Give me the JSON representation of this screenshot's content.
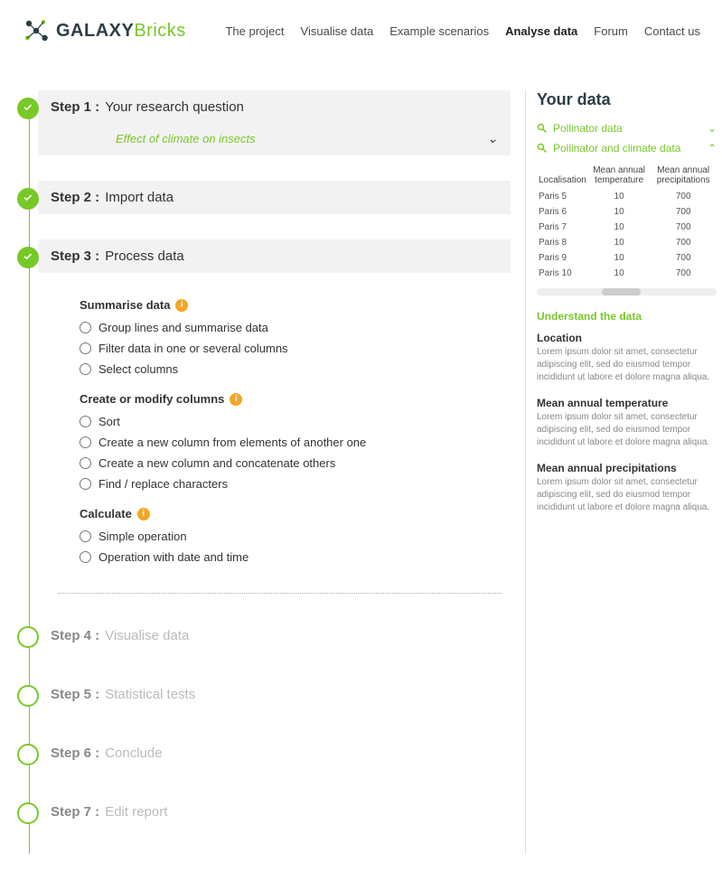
{
  "brand": {
    "part1": "GALAXY",
    "part2": "Bricks"
  },
  "nav": {
    "items": [
      "The project",
      "Visualise data",
      "Example scenarios",
      "Analyse data",
      "Forum",
      "Contact us"
    ],
    "activeIndex": 3
  },
  "steps": {
    "s1": {
      "bold": "Step 1 :",
      "label": "Your research question",
      "sub": "Effect of climate on insects"
    },
    "s2": {
      "bold": "Step 2 :",
      "label": "Import data"
    },
    "s3": {
      "bold": "Step 3 :",
      "label": "Process data",
      "group1": {
        "title": "Summarise data",
        "opts": [
          "Group lines and summarise data",
          "Filter data in one or several columns",
          "Select columns"
        ]
      },
      "group2": {
        "title": "Create or modify columns",
        "opts": [
          "Sort",
          "Create a new column from elements of another one",
          "Create a new column and concatenate others",
          "Find / replace characters"
        ]
      },
      "group3": {
        "title": "Calculate",
        "opts": [
          "Simple operation",
          "Operation with date and time"
        ]
      }
    },
    "s4": {
      "bold": "Step 4 :",
      "label": "Visualise data"
    },
    "s5": {
      "bold": "Step 5 :",
      "label": "Statistical tests"
    },
    "s6": {
      "bold": "Step 6 :",
      "label": "Conclude"
    },
    "s7": {
      "bold": "Step 7 :",
      "label": "Edit report"
    }
  },
  "panel": {
    "title": "Your data",
    "ds1": "Pollinator data",
    "ds2": "Pollinator and climate data",
    "cols": [
      "Localisation",
      "Mean annual temperature",
      "Mean annual precipitations"
    ],
    "rows": [
      [
        "Paris 5",
        "10",
        "700"
      ],
      [
        "Paris 6",
        "10",
        "700"
      ],
      [
        "Paris 7",
        "10",
        "700"
      ],
      [
        "Paris 8",
        "10",
        "700"
      ],
      [
        "Paris 9",
        "10",
        "700"
      ],
      [
        "Paris 10",
        "10",
        "700"
      ]
    ],
    "understand": "Understand the data",
    "defs": [
      {
        "h": "Location",
        "p": "Lorem ipsum dolor sit amet, consectetur adipiscing elit, sed do eiusmod tempor incididunt ut labore et dolore magna aliqua."
      },
      {
        "h": "Mean annual temperature",
        "p": "Lorem ipsum dolor sit amet, consectetur adipiscing elit, sed do eiusmod tempor incididunt ut labore et dolore magna aliqua."
      },
      {
        "h": "Mean annual precipitations",
        "p": "Lorem ipsum dolor sit amet, consectetur adipiscing elit, sed do eiusmod tempor incididunt ut labore et dolore magna aliqua."
      }
    ]
  }
}
